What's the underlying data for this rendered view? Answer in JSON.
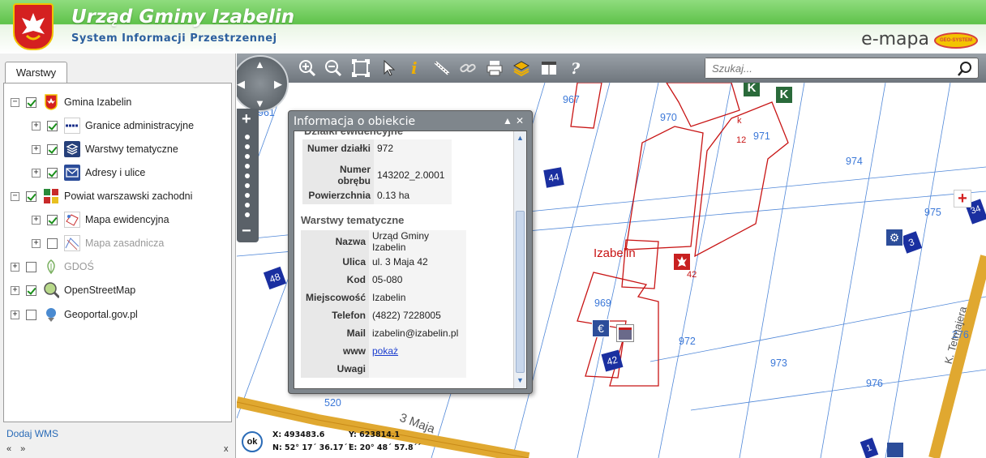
{
  "header": {
    "title": "Urząd Gminy Izabelin",
    "subtitle": "System Informacji Przestrzennej",
    "brand": "e-mapa",
    "brand_logo_text": "GEO-SYSTEM"
  },
  "left_panel": {
    "tab_label": "Warstwy",
    "layers": [
      {
        "label": "Gmina Izabelin",
        "checked": true,
        "level": 0,
        "icon": "crest-icon"
      },
      {
        "label": "Granice administracyjne",
        "checked": true,
        "level": 1,
        "icon": "boundary-icon"
      },
      {
        "label": "Warstwy tematyczne",
        "checked": true,
        "level": 1,
        "icon": "layers-icon"
      },
      {
        "label": "Adresy i ulice",
        "checked": true,
        "level": 1,
        "icon": "envelope-icon"
      },
      {
        "label": "Powiat warszawski zachodni",
        "checked": true,
        "level": 0,
        "icon": "county-crest-icon"
      },
      {
        "label": "Mapa ewidencyjna",
        "checked": true,
        "level": 1,
        "icon": "cadastral-map-icon"
      },
      {
        "label": "Mapa zasadnicza",
        "checked": false,
        "level": 1,
        "icon": "base-map-icon"
      },
      {
        "label": "GDOŚ",
        "checked": false,
        "level": 0,
        "icon": "leaf-icon"
      },
      {
        "label": "OpenStreetMap",
        "checked": true,
        "level": 0,
        "icon": "globe-magnifier-icon"
      },
      {
        "label": "Geoportal.gov.pl",
        "checked": false,
        "level": 0,
        "icon": "geoportal-icon"
      }
    ],
    "add_wms": "Dodaj WMS",
    "nav_arrows": "« »",
    "close": "x"
  },
  "toolbar": {
    "tools": [
      "zoom-in-icon",
      "zoom-out-icon",
      "zoom-extent-icon",
      "pointer-icon",
      "info-icon",
      "measure-icon",
      "link-icon",
      "print-icon",
      "layers-icon",
      "layout-icon",
      "help-icon"
    ],
    "search_placeholder": "Szukaj..."
  },
  "popup": {
    "title": "Informacja o obiekcie",
    "cut_heading": "Działki ewidencyjne",
    "parcel_rows": [
      {
        "key": "Numer działki",
        "value": "972"
      },
      {
        "key": "Numer obrębu",
        "value": "143202_2.0001"
      },
      {
        "key": "Powierzchnia",
        "value": "0.13 ha"
      }
    ],
    "section_title": "Warstwy tematyczne",
    "thematic_rows": [
      {
        "key": "Nazwa",
        "value": "Urząd Gminy Izabelin"
      },
      {
        "key": "Ulica",
        "value": "ul. 3 Maja 42"
      },
      {
        "key": "Kod",
        "value": "05-080"
      },
      {
        "key": "Miejscowość",
        "value": "Izabelin"
      },
      {
        "key": "Telefon",
        "value": "(4822) 7228005"
      },
      {
        "key": "Mail",
        "value": "izabelin@izabelin.pl"
      },
      {
        "key": "www",
        "value": "pokaż"
      },
      {
        "key": "Uwagi",
        "value": ""
      }
    ]
  },
  "map": {
    "plot_labels": [
      "961",
      "967",
      "970",
      "971",
      "974",
      "975",
      "969",
      "972",
      "973",
      "976",
      "276",
      "520"
    ],
    "house_numbers": [
      "44",
      "48",
      "42",
      "3",
      "12",
      "42",
      "k",
      "34",
      "1"
    ],
    "place_label": "Izabelin",
    "streets": [
      "3 Maja",
      "K. Tetmajera"
    ],
    "ok_label": "ok",
    "coords": {
      "x": "X: 493483.6",
      "y": "Y: 623814.1",
      "n": "N: 52° 17´ 36.17´´",
      "e": "E: 20° 48´ 57.8´´"
    }
  },
  "colors": {
    "parcel_line": "#c81414",
    "plot_label": "#3b78d8",
    "road": "#e0a830",
    "header_green": "#5fc24a"
  }
}
